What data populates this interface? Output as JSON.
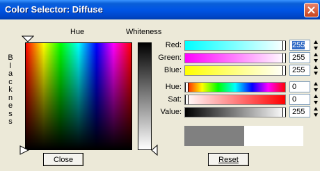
{
  "window": {
    "title": "Color Selector: Diffuse"
  },
  "labels": {
    "hue": "Hue",
    "whiteness": "Whiteness",
    "blackness_letters": [
      "B",
      "l",
      "a",
      "c",
      "k",
      "n",
      "e",
      "s",
      "s"
    ]
  },
  "channels": [
    {
      "label": "Red:",
      "value": "255"
    },
    {
      "label": "Green:",
      "value": "255"
    },
    {
      "label": "Blue:",
      "value": "255"
    },
    {
      "label": "Hue:",
      "value": "0"
    },
    {
      "label": "Sat:",
      "value": "0"
    },
    {
      "label": "Value:",
      "value": "255"
    }
  ],
  "buttons": {
    "close": "Close",
    "reset": "Reset"
  },
  "colors": {
    "red_bar": "#00ffff→#ffffff",
    "green_bar": "#ff00ff→#ffffff",
    "blue_bar": "#ffff00→#ffffff",
    "preview_old": "#808080",
    "preview_new": "#ffffff"
  },
  "icons": {
    "title_close": "close-icon",
    "spinner": "spinner-arrows-icon",
    "marker": "triangle-marker-icon"
  }
}
